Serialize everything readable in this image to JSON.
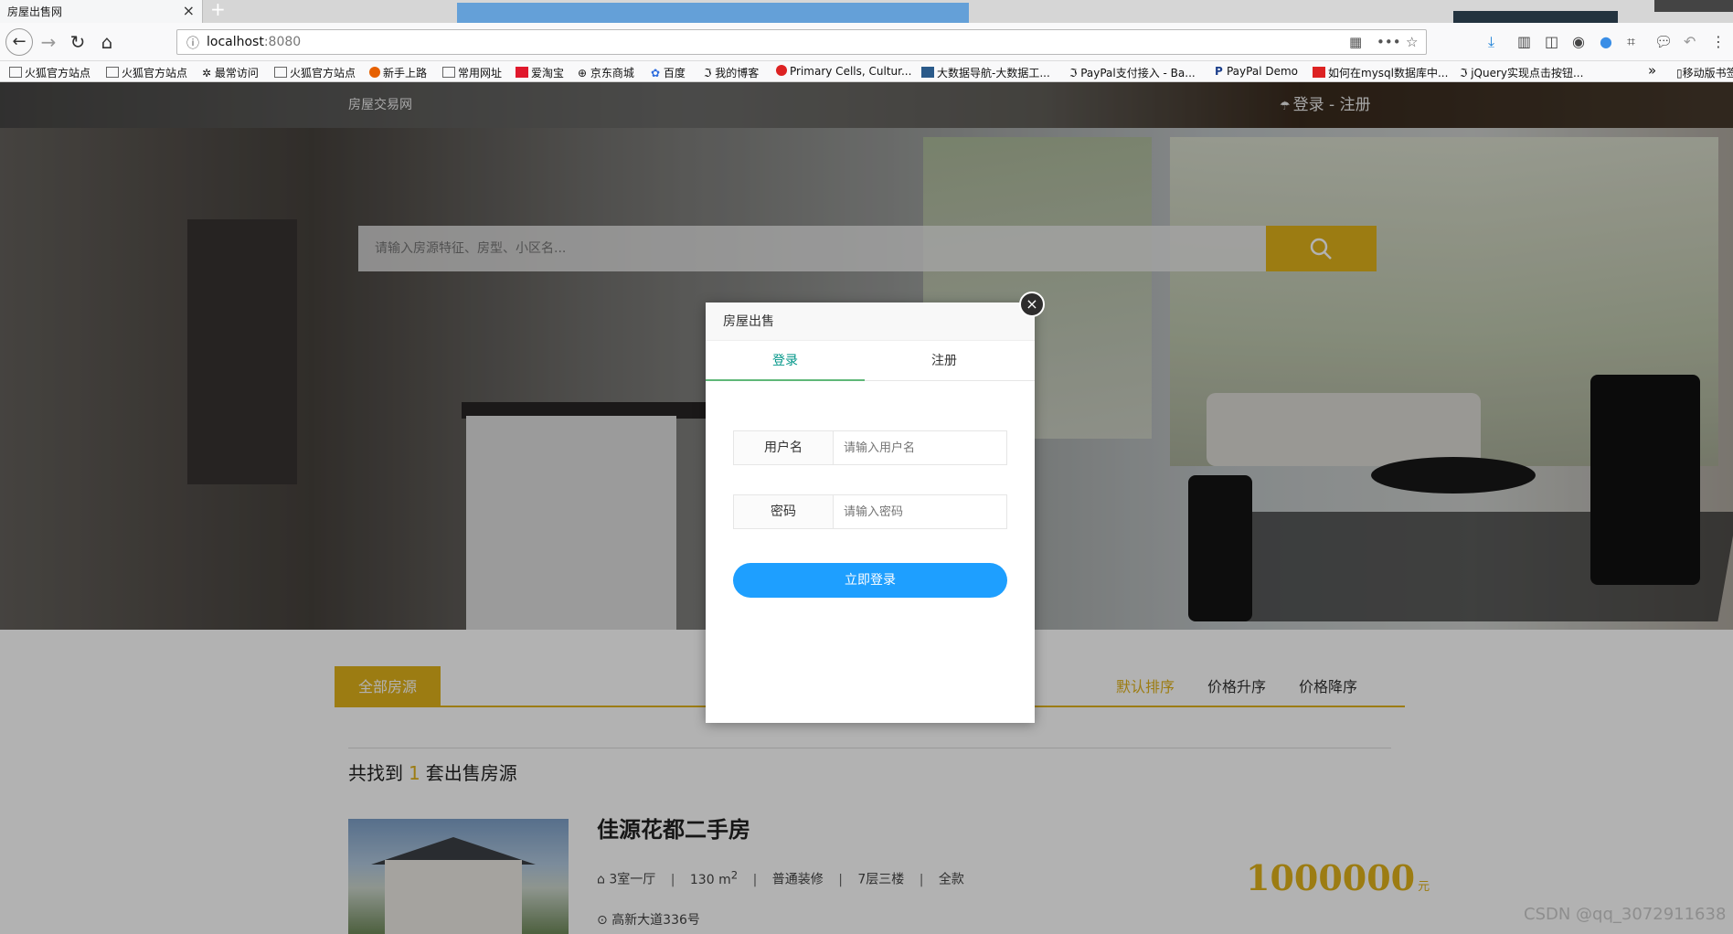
{
  "browser": {
    "tab_title": "房屋出售网",
    "tab_close": "×",
    "new_tab": "+",
    "url_host": "localhost",
    "url_port": ":8080",
    "bookmarks": [
      "火狐官方站点",
      "火狐官方站点",
      "最常访问",
      "火狐官方站点",
      "新手上路",
      "常用网址",
      "爱淘宝",
      "京东商城",
      "百度",
      "我的博客",
      "Primary Cells, Cultur...",
      "大数据导航-大数据工...",
      "PayPal支付接入 - Ba...",
      "PayPal Demo",
      "如何在mysql数据库中...",
      "jQuery实现点击按钮...",
      "移动版书签"
    ],
    "bookmarks_overflow": "»"
  },
  "header": {
    "logo": "房屋交易网",
    "login_register": "登录 - 注册"
  },
  "search": {
    "placeholder": "请输入房源特征、房型、小区名..."
  },
  "filter": {
    "all_tab": "全部房源",
    "sort_default": "默认排序",
    "sort_asc": "价格升序",
    "sort_desc": "价格降序"
  },
  "results": {
    "prefix": "共找到",
    "count": "1",
    "suffix": "套出售房源"
  },
  "listing": {
    "title": "佳源花都二手房",
    "layout": "3室一厅",
    "area": "130 m",
    "area_sup": "2",
    "decoration": "普通装修",
    "floor": "7层三楼",
    "payment": "全款",
    "separator": "|",
    "address": "高新大道336号",
    "price": "1000000",
    "price_unit": "元"
  },
  "modal": {
    "title": "房屋出售",
    "tab_login": "登录",
    "tab_register": "注册",
    "username_label": "用户名",
    "username_placeholder": "请输入用户名",
    "password_label": "密码",
    "password_placeholder": "请输入密码",
    "submit": "立即登录",
    "close": "×"
  },
  "watermark": "CSDN @qq_3072911638",
  "colors": {
    "accent": "#e0b21a",
    "primary_button": "#1e9fff",
    "tab_active": "#009688"
  }
}
